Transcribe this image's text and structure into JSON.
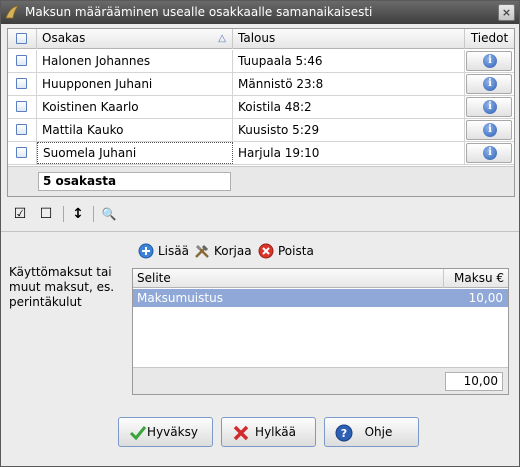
{
  "window": {
    "title": "Maksun määrääminen usealle osakkaalle samanaikaisesti",
    "close_label": "×"
  },
  "owners_table": {
    "columns": {
      "owner": "Osakas",
      "household": "Talous",
      "details": "Tiedot"
    },
    "rows": [
      {
        "owner": "Halonen Johannes",
        "household": "Tuupaala 5:46"
      },
      {
        "owner": "Huupponen Juhani",
        "household": "Männistö 23:8"
      },
      {
        "owner": "Koistinen Kaarlo",
        "household": "Koistila 48:2"
      },
      {
        "owner": "Mattila Kauko",
        "household": "Kuusisto 5:29"
      },
      {
        "owner": "Suomela Juhani",
        "household": "Harjula 19:10"
      }
    ],
    "info_glyph": "i",
    "count": "5 osakasta"
  },
  "toolbar": {
    "check_all": "☑",
    "uncheck_all": "☐",
    "sort": "↕",
    "search": "🔍"
  },
  "fees": {
    "label": "Käyttömaksut tai\nmuut maksut, es.\nperintäkulut",
    "actions": {
      "add": "Lisää",
      "edit": "Korjaa",
      "delete": "Poista"
    },
    "columns": {
      "description": "Selite",
      "amount": "Maksu €"
    },
    "rows": [
      {
        "description": "Maksumuistus",
        "amount": "10,00"
      }
    ],
    "total": "10,00"
  },
  "buttons": {
    "accept": "Hyväksy",
    "reject": "Hylkää",
    "help": "Ohje"
  },
  "colors": {
    "accent": "#5a7fbf",
    "selection": "#8fa8d8",
    "titlebar": "#4a4a4a"
  }
}
